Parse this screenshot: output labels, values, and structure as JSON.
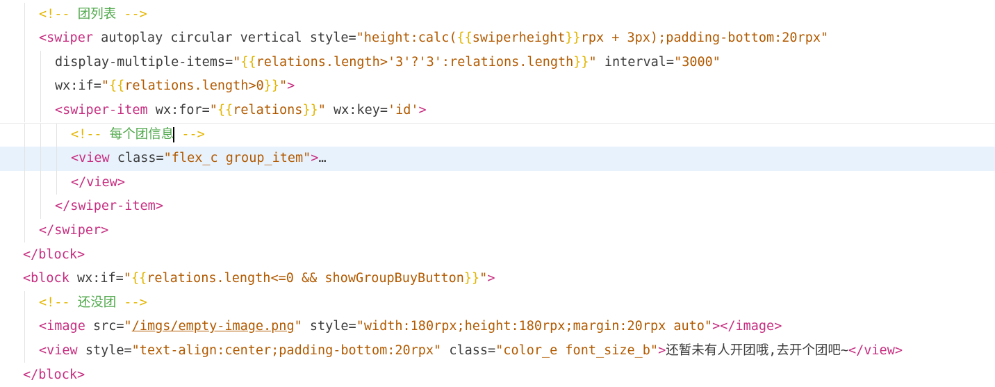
{
  "colors": {
    "comment": "#e4b600",
    "comment_text": "#4fa84a",
    "tag": "#c72d80",
    "attr": "#3b3b3b",
    "string": "#b25a00",
    "brace": "#e2b500",
    "plain": "#3b3b3b",
    "active_line_bg": "#e8f2fc"
  },
  "editor": {
    "lines": [
      {
        "indent": 1,
        "tokens": [
          {
            "t": "<!-- ",
            "c": "comment"
          },
          {
            "t": "团列表",
            "c": "comment_text"
          },
          {
            "t": " -->",
            "c": "comment"
          }
        ]
      },
      {
        "indent": 1,
        "tokens": [
          {
            "t": "<",
            "c": "tag"
          },
          {
            "t": "swiper",
            "c": "tag"
          },
          {
            "t": " autoplay circular vertical style=",
            "c": "attr"
          },
          {
            "t": "\"height:calc(",
            "c": "string"
          },
          {
            "t": "{{",
            "c": "brace"
          },
          {
            "t": "swiperheight",
            "c": "string"
          },
          {
            "t": "}}",
            "c": "brace"
          },
          {
            "t": "rpx + 3px);padding-bottom:20rpx\"",
            "c": "string"
          }
        ]
      },
      {
        "indent": 2,
        "tokens": [
          {
            "t": "display-multiple-items=",
            "c": "attr"
          },
          {
            "t": "\"",
            "c": "string"
          },
          {
            "t": "{{",
            "c": "brace"
          },
          {
            "t": "relations.length>'3'?'3':relations.length",
            "c": "string"
          },
          {
            "t": "}}",
            "c": "brace"
          },
          {
            "t": "\"",
            "c": "string"
          },
          {
            "t": " interval=",
            "c": "attr"
          },
          {
            "t": "\"3000\"",
            "c": "string"
          }
        ]
      },
      {
        "indent": 2,
        "tokens": [
          {
            "t": "wx:if=",
            "c": "attr"
          },
          {
            "t": "\"",
            "c": "string"
          },
          {
            "t": "{{",
            "c": "brace"
          },
          {
            "t": "relations.length>0",
            "c": "string"
          },
          {
            "t": "}}",
            "c": "brace"
          },
          {
            "t": "\"",
            "c": "string"
          },
          {
            "t": ">",
            "c": "tag"
          }
        ]
      },
      {
        "indent": 2,
        "tokens": [
          {
            "t": "<",
            "c": "tag"
          },
          {
            "t": "swiper-item",
            "c": "tag"
          },
          {
            "t": " wx:for=",
            "c": "attr"
          },
          {
            "t": "\"",
            "c": "string"
          },
          {
            "t": "{{",
            "c": "brace"
          },
          {
            "t": "relations",
            "c": "string"
          },
          {
            "t": "}}",
            "c": "brace"
          },
          {
            "t": "\"",
            "c": "string"
          },
          {
            "t": " wx:key=",
            "c": "attr"
          },
          {
            "t": "'id'",
            "c": "string"
          },
          {
            "t": ">",
            "c": "tag"
          }
        ]
      },
      {
        "indent": 3,
        "tokens": [
          {
            "t": "<!-- ",
            "c": "comment"
          },
          {
            "t": "每个团信息",
            "c": "comment_text"
          },
          {
            "t": "|",
            "c": "cursor"
          },
          {
            "t": " -->",
            "c": "comment"
          }
        ]
      },
      {
        "indent": 3,
        "active": true,
        "tokens": [
          {
            "t": "<",
            "c": "tag"
          },
          {
            "t": "view",
            "c": "tag"
          },
          {
            "t": " class=",
            "c": "attr"
          },
          {
            "t": "\"flex_c group_item\"",
            "c": "string"
          },
          {
            "t": ">",
            "c": "tag"
          },
          {
            "t": "…",
            "c": "plain"
          }
        ]
      },
      {
        "indent": 3,
        "tokens": [
          {
            "t": "</",
            "c": "tag"
          },
          {
            "t": "view",
            "c": "tag"
          },
          {
            "t": ">",
            "c": "tag"
          }
        ]
      },
      {
        "indent": 2,
        "tokens": [
          {
            "t": "</",
            "c": "tag"
          },
          {
            "t": "swiper-item",
            "c": "tag"
          },
          {
            "t": ">",
            "c": "tag"
          }
        ]
      },
      {
        "indent": 1,
        "tokens": [
          {
            "t": "</",
            "c": "tag"
          },
          {
            "t": "swiper",
            "c": "tag"
          },
          {
            "t": ">",
            "c": "tag"
          }
        ]
      },
      {
        "indent": 0,
        "tokens": [
          {
            "t": "</",
            "c": "tag"
          },
          {
            "t": "block",
            "c": "tag"
          },
          {
            "t": ">",
            "c": "tag"
          }
        ]
      },
      {
        "indent": 0,
        "tokens": [
          {
            "t": "<",
            "c": "tag"
          },
          {
            "t": "block",
            "c": "tag"
          },
          {
            "t": " wx:if=",
            "c": "attr"
          },
          {
            "t": "\"",
            "c": "string"
          },
          {
            "t": "{{",
            "c": "brace"
          },
          {
            "t": "relations.length<=0 && showGroupBuyButton",
            "c": "string"
          },
          {
            "t": "}}",
            "c": "brace"
          },
          {
            "t": "\"",
            "c": "string"
          },
          {
            "t": ">",
            "c": "tag"
          }
        ]
      },
      {
        "indent": 1,
        "tokens": [
          {
            "t": "<!-- ",
            "c": "comment"
          },
          {
            "t": "还没团",
            "c": "comment_text"
          },
          {
            "t": " -->",
            "c": "comment"
          }
        ]
      },
      {
        "indent": 1,
        "tokens": [
          {
            "t": "<",
            "c": "tag"
          },
          {
            "t": "image",
            "c": "tag"
          },
          {
            "t": " src=",
            "c": "attr"
          },
          {
            "t": "\"",
            "c": "string"
          },
          {
            "t": "/imgs/empty-image.png",
            "c": "string",
            "u": true
          },
          {
            "t": "\"",
            "c": "string"
          },
          {
            "t": " style=",
            "c": "attr"
          },
          {
            "t": "\"width:180rpx;height:180rpx;margin:20rpx auto\"",
            "c": "string"
          },
          {
            "t": ">",
            "c": "tag"
          },
          {
            "t": "</",
            "c": "tag"
          },
          {
            "t": "image",
            "c": "tag"
          },
          {
            "t": ">",
            "c": "tag"
          }
        ]
      },
      {
        "indent": 1,
        "tokens": [
          {
            "t": "<",
            "c": "tag"
          },
          {
            "t": "view",
            "c": "tag"
          },
          {
            "t": " style=",
            "c": "attr"
          },
          {
            "t": "\"text-align:center;padding-bottom:20rpx\"",
            "c": "string"
          },
          {
            "t": " class=",
            "c": "attr"
          },
          {
            "t": "\"color_e font_size_b\"",
            "c": "string"
          },
          {
            "t": ">",
            "c": "tag"
          },
          {
            "t": "还暂未有人开团哦,去开个团吧~",
            "c": "plain"
          },
          {
            "t": "</",
            "c": "tag"
          },
          {
            "t": "view",
            "c": "tag"
          },
          {
            "t": ">",
            "c": "tag"
          }
        ]
      },
      {
        "indent": 0,
        "tokens": [
          {
            "t": "</",
            "c": "tag"
          },
          {
            "t": "block",
            "c": "tag"
          },
          {
            "t": ">",
            "c": "tag"
          }
        ]
      }
    ]
  }
}
